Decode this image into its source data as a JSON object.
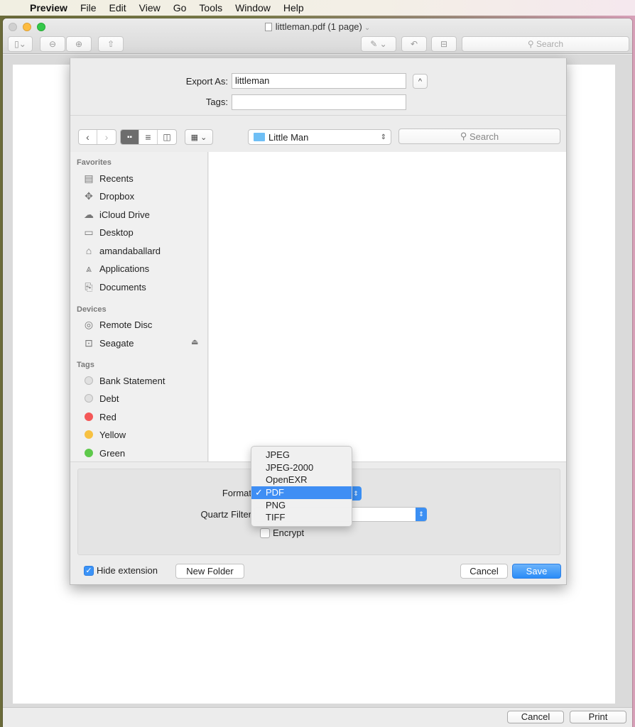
{
  "menubar": {
    "apple": "",
    "app": "Preview",
    "items": [
      "File",
      "Edit",
      "View",
      "Go",
      "Tools",
      "Window",
      "Help"
    ]
  },
  "window": {
    "title": "littleman.pdf (1 page)",
    "search_placeholder": "Search",
    "bottom": {
      "cancel": "Cancel",
      "print": "Print"
    }
  },
  "dialog": {
    "export_as_label": "Export As:",
    "export_as_value": "littleman",
    "tags_label": "Tags:",
    "tags_value": "",
    "collapse_icon": "^",
    "location": "Little Man",
    "search_placeholder": "Search",
    "sidebar": {
      "favorites_header": "Favorites",
      "favorites": [
        {
          "label": "Recents",
          "icon": "recents-icon"
        },
        {
          "label": "Dropbox",
          "icon": "dropbox-icon"
        },
        {
          "label": "iCloud Drive",
          "icon": "cloud-icon"
        },
        {
          "label": "Desktop",
          "icon": "desktop-icon"
        },
        {
          "label": "amandaballard",
          "icon": "home-icon"
        },
        {
          "label": "Applications",
          "icon": "applications-icon"
        },
        {
          "label": "Documents",
          "icon": "documents-icon"
        }
      ],
      "devices_header": "Devices",
      "devices": [
        {
          "label": "Remote Disc",
          "icon": "disc-icon"
        },
        {
          "label": "Seagate",
          "icon": "drive-icon",
          "eject": true
        }
      ],
      "tags_header": "Tags",
      "tags": [
        {
          "label": "Bank Statement",
          "color": "#e0e0e0"
        },
        {
          "label": "Debt",
          "color": "#e0e0e0"
        },
        {
          "label": "Red",
          "color": "#f45757"
        },
        {
          "label": "Yellow",
          "color": "#f7c142"
        },
        {
          "label": "Green",
          "color": "#5ec94b"
        }
      ]
    },
    "format_label": "Format",
    "quartz_label": "Quartz Filter",
    "encrypt_label": "Encrypt",
    "encrypt_checked": false,
    "format_menu": {
      "options": [
        "JPEG",
        "JPEG-2000",
        "OpenEXR",
        "PDF",
        "PNG",
        "TIFF"
      ],
      "selected": "PDF",
      "check": "✓"
    },
    "hide_extension_label": "Hide extension",
    "hide_extension_checked": true,
    "new_folder": "New Folder",
    "cancel": "Cancel",
    "save": "Save",
    "accent": "#3f8ef4"
  }
}
